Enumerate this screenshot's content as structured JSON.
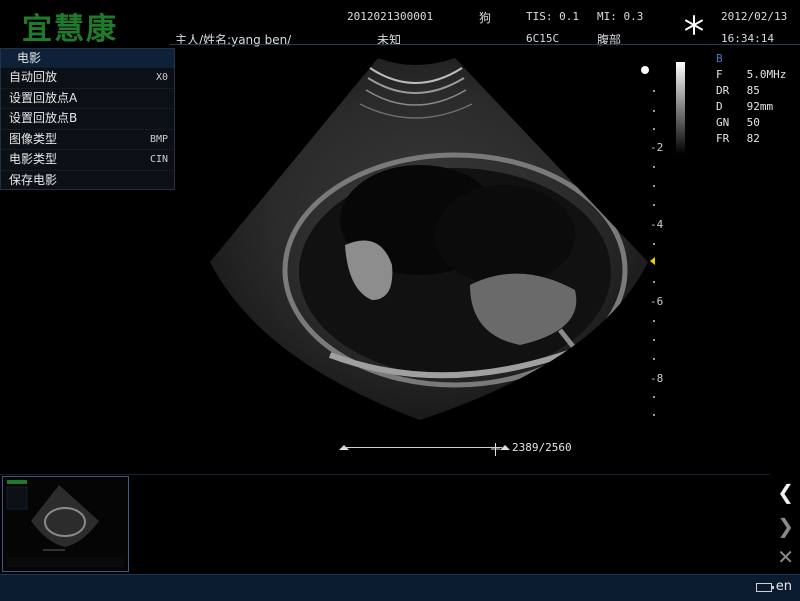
{
  "header": {
    "logo": "宜慧康",
    "patient_id": "2012021300001",
    "species": "狗",
    "tis": "TIS: 0.1",
    "mi": "MI: 0.3",
    "date": "2012/02/13",
    "owner": "主人/姓名:yang ben/",
    "sex": "未知",
    "probe": "6C15C",
    "exam": "腹部",
    "time": "16:34:14"
  },
  "cine_menu": {
    "title": "电影",
    "items": [
      {
        "label": "自动回放",
        "value": "X0"
      },
      {
        "label": "设置回放点A",
        "value": ""
      },
      {
        "label": "设置回放点B",
        "value": ""
      },
      {
        "label": "图像类型",
        "value": "BMP"
      },
      {
        "label": "电影类型",
        "value": "CIN"
      },
      {
        "label": "保存电影",
        "value": ""
      }
    ]
  },
  "params": {
    "mode": "B",
    "rows": [
      {
        "k": "F",
        "v": "5.0MHz"
      },
      {
        "k": "DR",
        "v": "85"
      },
      {
        "k": "D",
        "v": "92mm"
      },
      {
        "k": "GN",
        "v": "50"
      },
      {
        "k": "FR",
        "v": "82"
      }
    ]
  },
  "depth_scale": [
    "-2",
    "-4",
    "-6",
    "-8"
  ],
  "cine_counter": "2389/2560",
  "footer": {
    "language": "en"
  }
}
